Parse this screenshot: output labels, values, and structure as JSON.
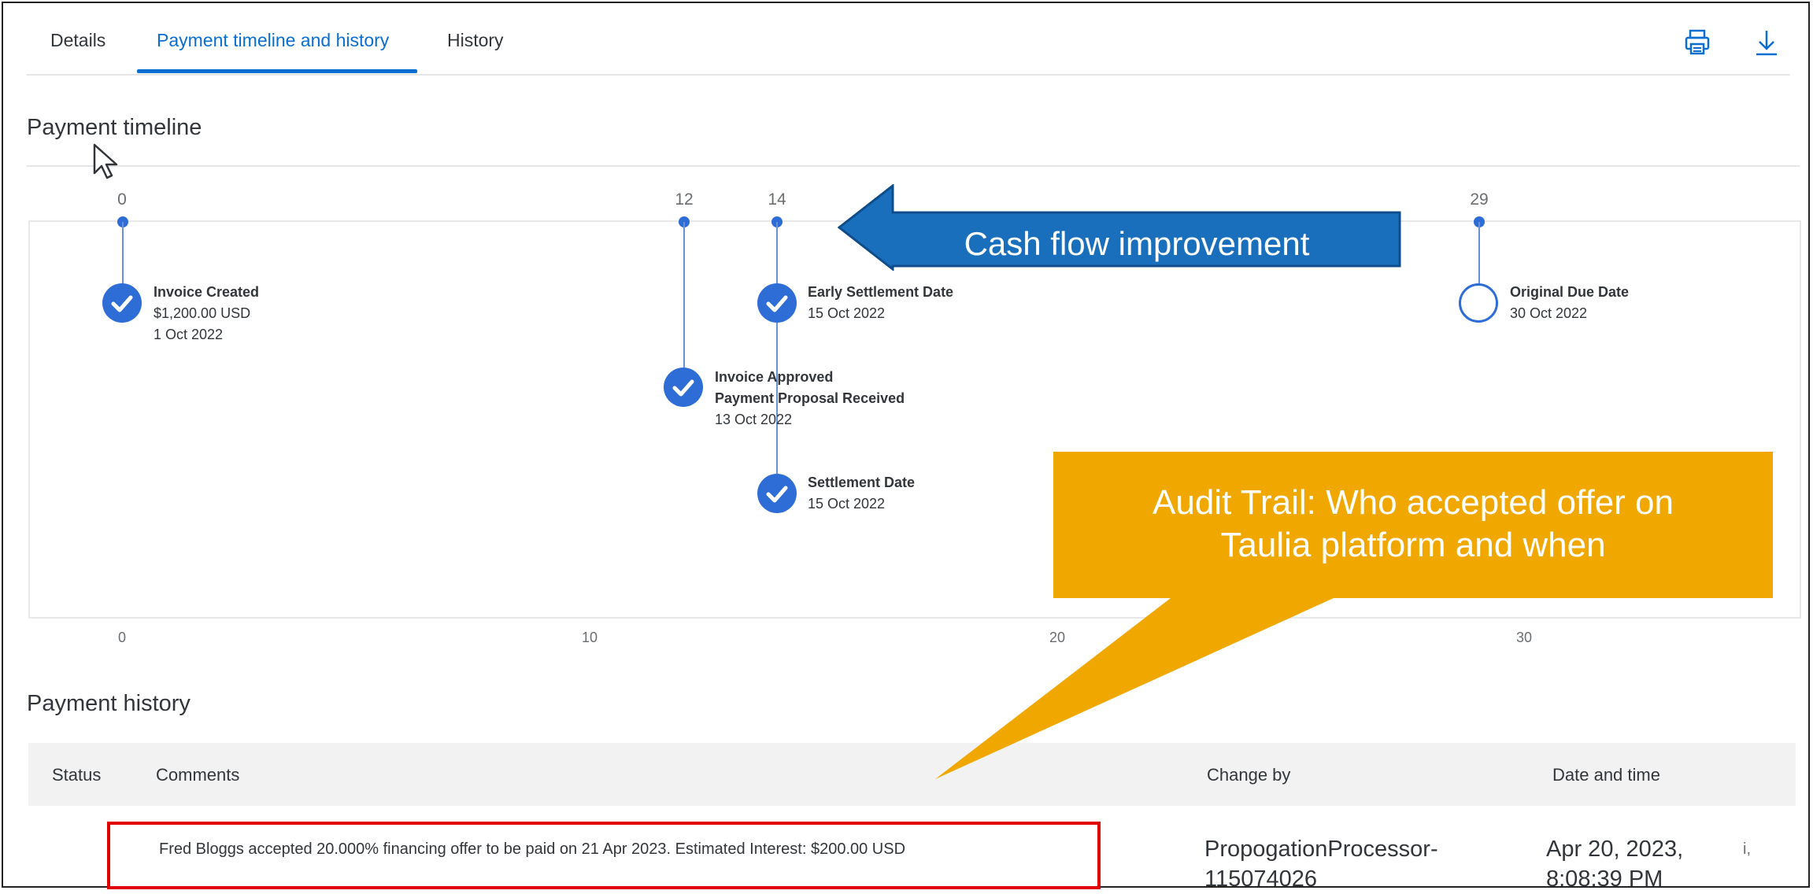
{
  "tabs": [
    {
      "label": "Details",
      "active": false
    },
    {
      "label": "Payment timeline and history",
      "active": true
    },
    {
      "label": "History",
      "active": false
    }
  ],
  "toolbar": {
    "print_icon": "printer-icon",
    "download_icon": "download-icon",
    "accent": "#0a6ed1"
  },
  "timeline": {
    "title": "Payment timeline",
    "day_ticks": [
      "0",
      "12",
      "14",
      "29"
    ],
    "axis_ticks": [
      "0",
      "10",
      "20",
      "30"
    ],
    "events": [
      {
        "day": 0,
        "status": "done",
        "title": "Invoice Created",
        "line2": "$1,200.00 USD",
        "line3": "1 Oct 2022"
      },
      {
        "day": 12,
        "status": "done",
        "title": "Invoice Approved",
        "line2": "Payment Proposal Received",
        "line3": "13 Oct 2022"
      },
      {
        "day": 14,
        "status": "done",
        "title": "Early Settlement Date",
        "line2": "15 Oct 2022"
      },
      {
        "day": 14,
        "status": "done",
        "title": "Settlement Date",
        "line2": "15 Oct 2022"
      },
      {
        "day": 29,
        "status": "open",
        "title": "Original Due Date",
        "line2": "30 Oct 2022"
      }
    ],
    "marker_color": "#2f6dd6"
  },
  "annotations": {
    "arrow_text": "Cash flow improvement",
    "arrow_color": "#1a6fbd",
    "callout_text_line1": "Audit Trail: Who accepted offer on",
    "callout_text_line2": "Taulia platform and when",
    "callout_color": "#f0a800"
  },
  "history": {
    "title": "Payment history",
    "columns": {
      "status": "Status",
      "comments": "Comments",
      "change_by": "Change by",
      "date_time": "Date and time"
    },
    "rows": [
      {
        "status": "",
        "comment": "Fred Bloggs accepted 20.000% financing offer to be paid on 21 Apr 2023. Estimated Interest: $200.00 USD",
        "change_by_line1": "PropogationProcessor-",
        "change_by_line2": "115074026",
        "date_line1": "Apr 20, 2023,",
        "date_line2": "8:08:39 PM",
        "extra": "i,"
      }
    ],
    "highlight_color": "#e00000"
  }
}
